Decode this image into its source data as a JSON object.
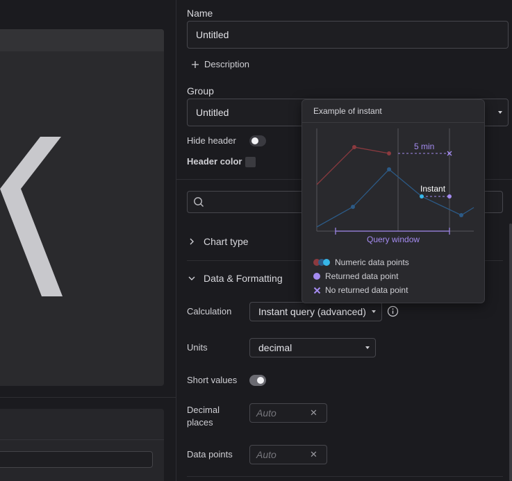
{
  "form": {
    "name_label": "Name",
    "name_value": "Untitled",
    "description_button": "Description",
    "group_label": "Group",
    "group_value": "Untitled",
    "hide_header_label": "Hide header",
    "hide_header_on": false,
    "header_color_label": "Header color",
    "search_placeholder": ""
  },
  "sections": {
    "chart_type": "Chart type",
    "data_formatting": "Data & Formatting"
  },
  "data_formatting": {
    "calculation_label": "Calculation",
    "calculation_value": "Instant query (advanced)",
    "units_label": "Units",
    "units_value": "decimal",
    "short_values_label": "Short values",
    "short_values_on": true,
    "decimal_places_label_line1": "Decimal",
    "decimal_places_label_line2": "places",
    "decimal_places_placeholder": "Auto",
    "data_points_label": "Data points",
    "data_points_placeholder": "Auto"
  },
  "tooltip": {
    "title": "Example of instant",
    "label_5min": "5 min",
    "label_instant": "Instant",
    "label_query_window": "Query window",
    "legend": [
      {
        "icon": "numeric-dots-icon",
        "text": "Numeric data points"
      },
      {
        "icon": "returned-dot-icon",
        "text": "Returned data point"
      },
      {
        "icon": "no-point-x-icon",
        "text": "No returned data point"
      }
    ],
    "colors": {
      "red_series": "#8b3a3f",
      "blue_series": "#2c5a86",
      "cyan_point": "#37b6e8",
      "purple": "#a48bf0",
      "axis": "#55555b"
    }
  },
  "icons": {
    "plus": "plus-icon",
    "chevron_right": "chevron-right-icon",
    "chevron_down": "chevron-down-icon",
    "search": "search-icon",
    "info": "info-icon",
    "clear": "close-icon"
  }
}
